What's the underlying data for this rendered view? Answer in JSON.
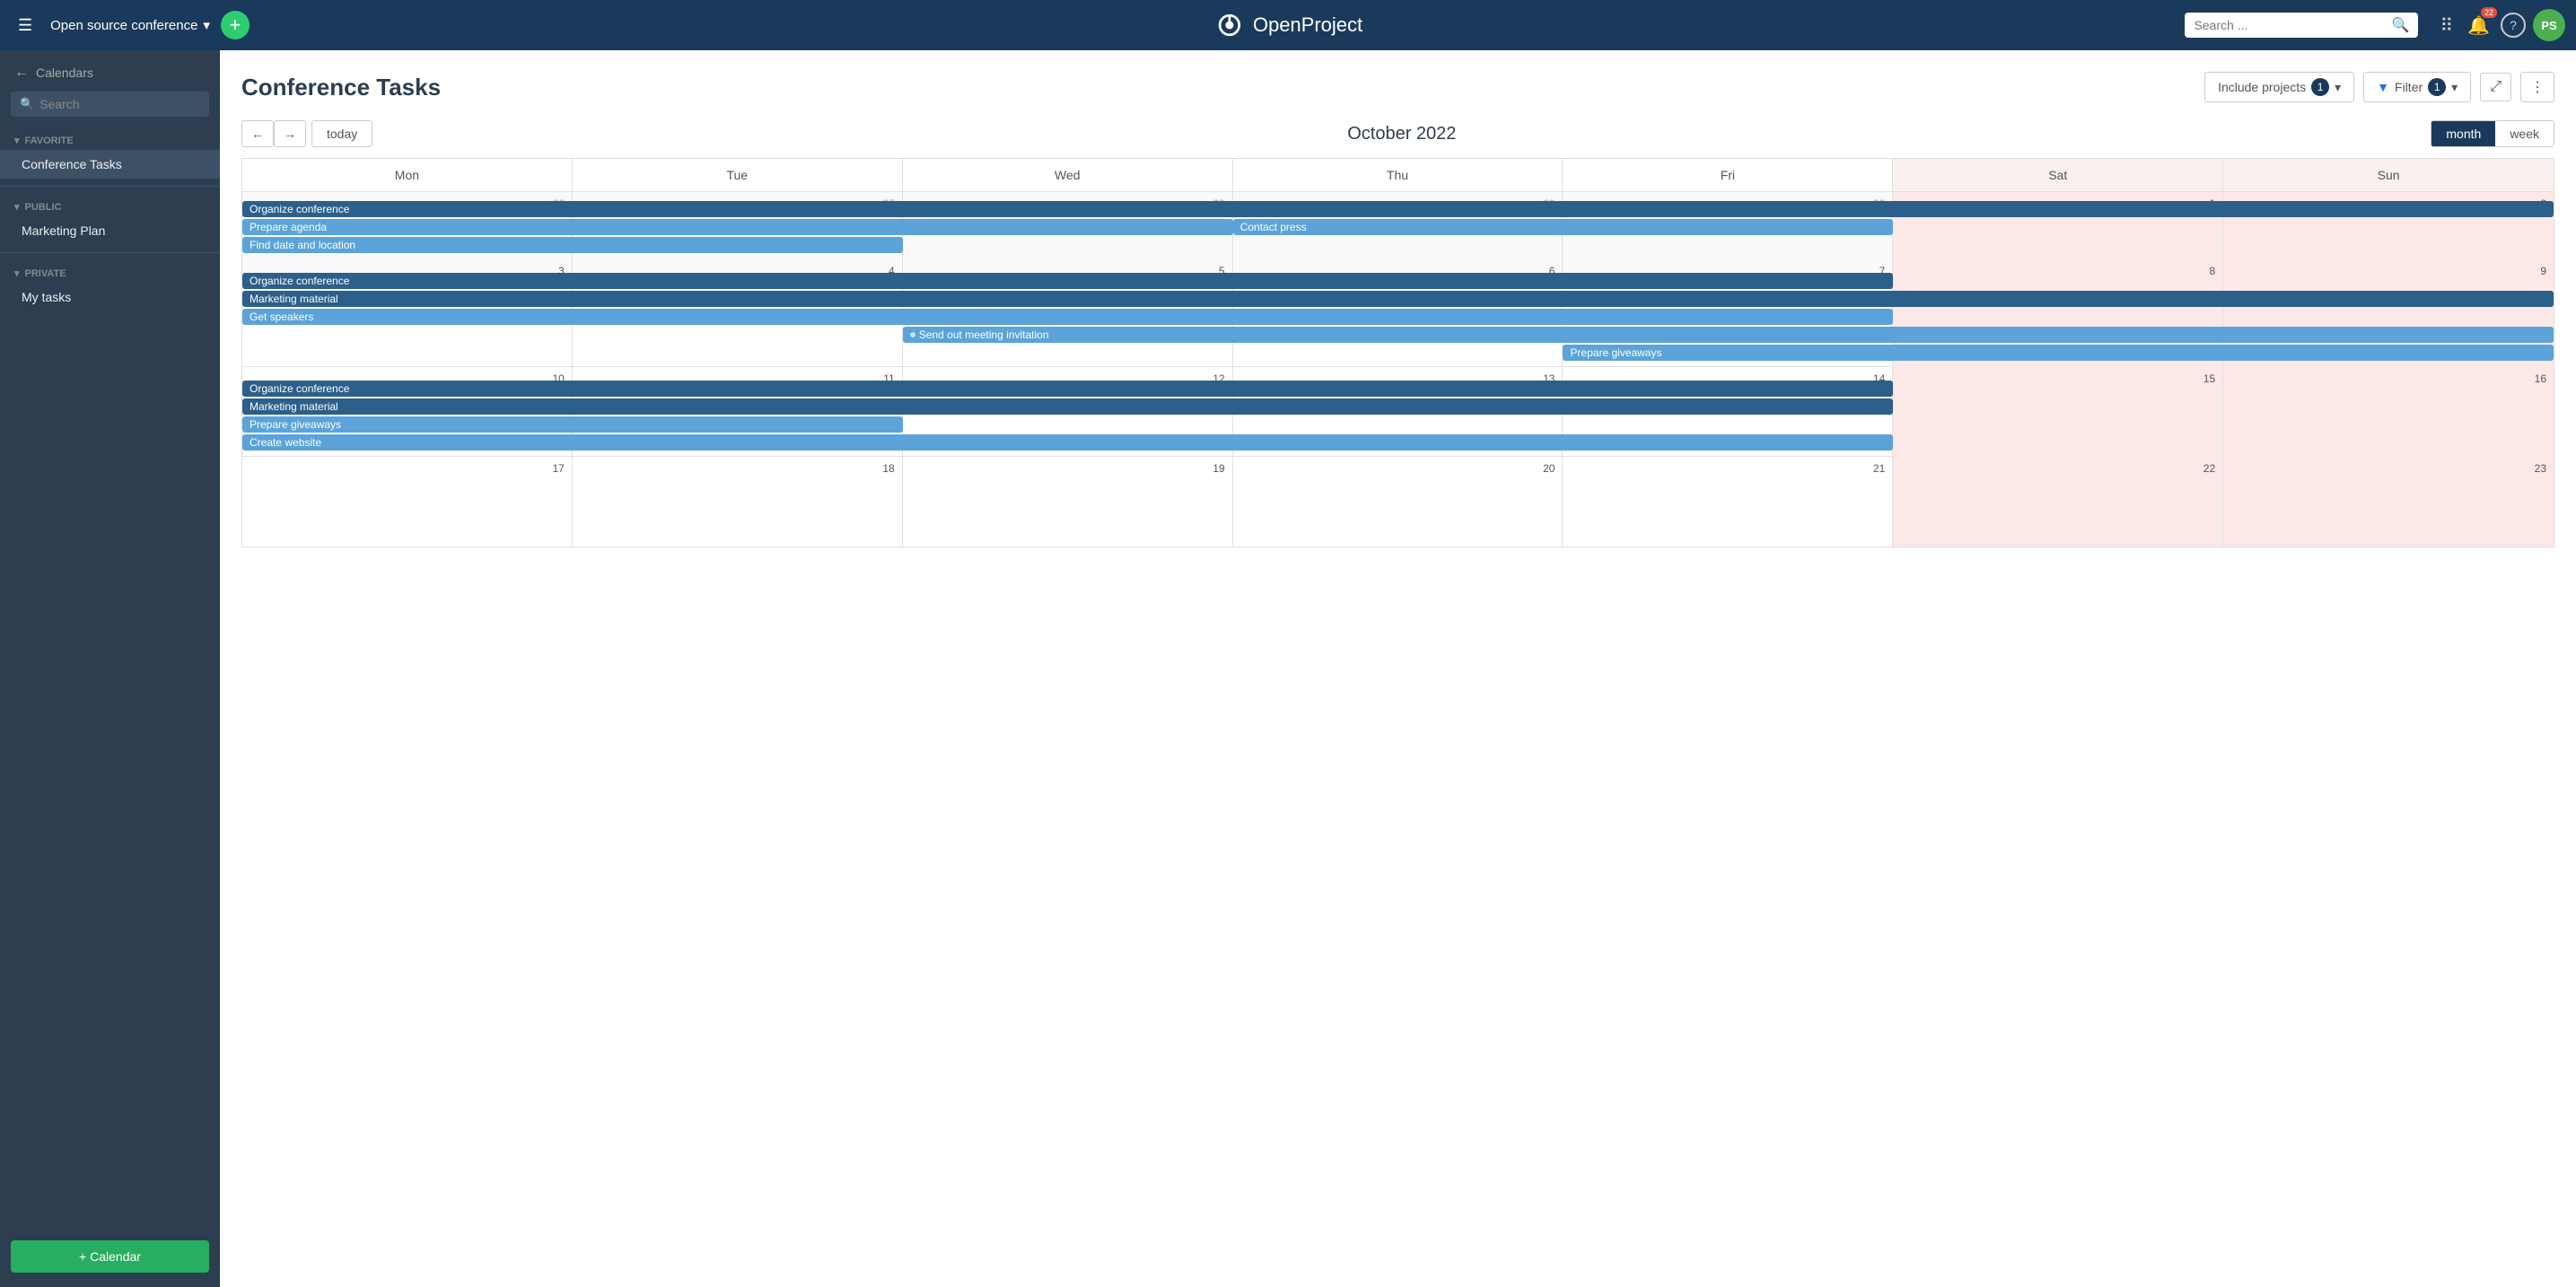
{
  "topNav": {
    "hamburger": "☰",
    "projectName": "Open source conference",
    "addBtn": "+",
    "logoText": "OpenProject",
    "searchPlaceholder": "Search ...",
    "notifCount": "22",
    "helpIcon": "?",
    "avatarText": "PS",
    "navGridIcon": "⠿"
  },
  "sidebar": {
    "backLabel": "Calendars",
    "searchPlaceholder": "Search",
    "sections": [
      {
        "label": "FAVORITE",
        "items": [
          "Conference Tasks"
        ]
      },
      {
        "label": "PUBLIC",
        "items": [
          "Marketing Plan"
        ]
      },
      {
        "label": "PRIVATE",
        "items": [
          "My tasks"
        ]
      }
    ],
    "addCalendarLabel": "+ Calendar"
  },
  "calendarPage": {
    "title": "Conference Tasks",
    "includeBtn": "Include projects",
    "includeCount": "1",
    "filterBtn": "Filter",
    "filterCount": "1",
    "fullscreenBtn": "⤢",
    "moreBtn": "⋮",
    "navPrev": "←",
    "navNext": "→",
    "todayBtn": "today",
    "monthTitle": "October 2022",
    "viewMonth": "month",
    "viewWeek": "week",
    "dayHeaders": [
      "Mon",
      "Tue",
      "Wed",
      "Thu",
      "Fri",
      "Sat",
      "Sun"
    ],
    "weeks": [
      {
        "cells": [
          {
            "num": "26",
            "otherMonth": true,
            "weekend": false
          },
          {
            "num": "27",
            "otherMonth": true,
            "weekend": false
          },
          {
            "num": "28",
            "otherMonth": true,
            "weekend": false
          },
          {
            "num": "29",
            "otherMonth": true,
            "weekend": false
          },
          {
            "num": "30",
            "otherMonth": true,
            "weekend": false
          },
          {
            "num": "1",
            "otherMonth": false,
            "weekend": true
          },
          {
            "num": "2",
            "otherMonth": false,
            "weekend": true
          }
        ],
        "events": [
          {
            "label": "Organize conference",
            "color": "dark-blue",
            "startCol": 0,
            "span": 7
          },
          {
            "label": "Prepare agenda",
            "color": "light-blue",
            "startCol": 0,
            "span": 3
          },
          {
            "label": "Contact press",
            "color": "light-blue",
            "startCol": 3,
            "span": 2
          },
          {
            "label": "Find date and location",
            "color": "light-blue",
            "startCol": 0,
            "span": 2
          }
        ]
      },
      {
        "cells": [
          {
            "num": "3",
            "otherMonth": false,
            "weekend": false
          },
          {
            "num": "4",
            "otherMonth": false,
            "weekend": false
          },
          {
            "num": "5",
            "otherMonth": false,
            "weekend": false
          },
          {
            "num": "6",
            "otherMonth": false,
            "weekend": false
          },
          {
            "num": "7",
            "otherMonth": false,
            "weekend": false
          },
          {
            "num": "8",
            "otherMonth": false,
            "weekend": true
          },
          {
            "num": "9",
            "otherMonth": false,
            "weekend": true
          }
        ],
        "events": [
          {
            "label": "Organize conference",
            "color": "dark-blue",
            "startCol": 0,
            "span": 5
          },
          {
            "label": "Marketing material",
            "color": "dark-blue",
            "startCol": 0,
            "span": 7
          },
          {
            "label": "Get speakers",
            "color": "light-blue",
            "startCol": 0,
            "span": 5
          },
          {
            "label": "Send out meeting invitation",
            "color": "light-blue",
            "startCol": 2,
            "span": 5
          },
          {
            "label": "Prepare giveaways",
            "color": "light-blue",
            "startCol": 4,
            "span": 3
          }
        ]
      },
      {
        "cells": [
          {
            "num": "10",
            "otherMonth": false,
            "weekend": false
          },
          {
            "num": "11",
            "otherMonth": false,
            "weekend": false
          },
          {
            "num": "12",
            "otherMonth": false,
            "weekend": false
          },
          {
            "num": "13",
            "otherMonth": false,
            "weekend": false
          },
          {
            "num": "14",
            "otherMonth": false,
            "weekend": false
          },
          {
            "num": "15",
            "otherMonth": false,
            "weekend": true
          },
          {
            "num": "16",
            "otherMonth": false,
            "weekend": true
          }
        ],
        "events": [
          {
            "label": "Organize conference",
            "color": "dark-blue",
            "startCol": 0,
            "span": 5
          },
          {
            "label": "Marketing material",
            "color": "dark-blue",
            "startCol": 0,
            "span": 5
          },
          {
            "label": "Prepare giveaways",
            "color": "light-blue",
            "startCol": 0,
            "span": 2
          },
          {
            "label": "Create website",
            "color": "light-blue",
            "startCol": 0,
            "span": 5
          }
        ]
      },
      {
        "cells": [
          {
            "num": "17",
            "otherMonth": false,
            "weekend": false
          },
          {
            "num": "18",
            "otherMonth": false,
            "weekend": false
          },
          {
            "num": "19",
            "otherMonth": false,
            "weekend": false
          },
          {
            "num": "20",
            "otherMonth": false,
            "weekend": false
          },
          {
            "num": "21",
            "otherMonth": false,
            "weekend": false
          },
          {
            "num": "22",
            "otherMonth": false,
            "weekend": true
          },
          {
            "num": "23",
            "otherMonth": false,
            "weekend": true
          }
        ],
        "events": []
      }
    ]
  }
}
